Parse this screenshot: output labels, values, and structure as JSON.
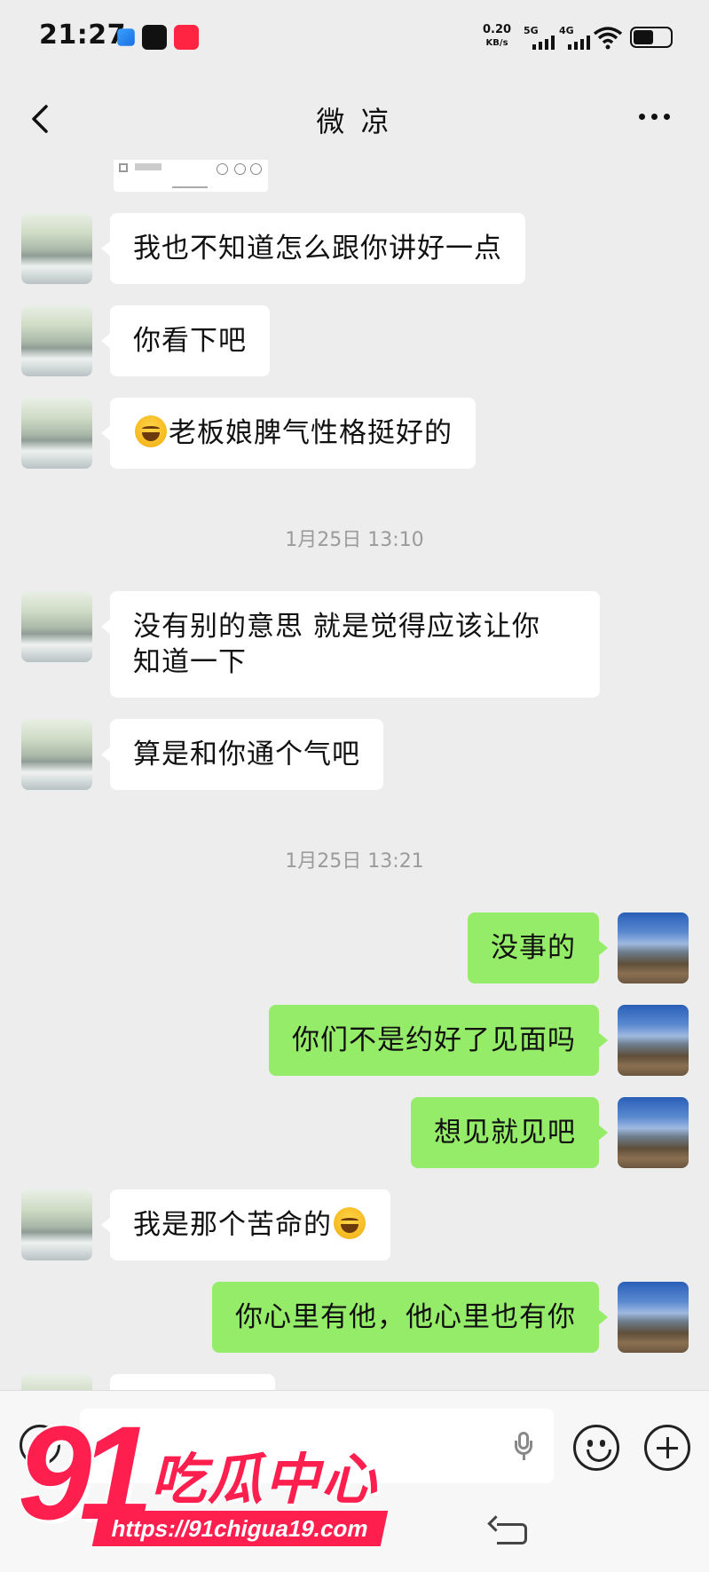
{
  "status_bar": {
    "time": "21:27",
    "net_speed_value": "0.20",
    "net_speed_unit": "KB/s",
    "signal1_label": "5G",
    "signal2_label": "4G"
  },
  "header": {
    "title": "微 凉"
  },
  "messages": [
    {
      "side": "left",
      "text": "我也不知道怎么跟你讲好一点"
    },
    {
      "side": "left",
      "text": "你看下吧"
    },
    {
      "side": "left",
      "text": "老板娘脾气性格挺好的",
      "emoji_before": "face-with-tears-of-joy"
    },
    {
      "side": "left",
      "text": "没有别的意思 就是觉得应该让你",
      "text2": "知道一下"
    },
    {
      "side": "left",
      "text": "算是和你通个气吧"
    },
    {
      "side": "right",
      "text": "没事的"
    },
    {
      "side": "right",
      "text": "你们不是约好了见面吗"
    },
    {
      "side": "right",
      "text": "想见就见吧"
    },
    {
      "side": "left",
      "text": "我是那个苦命的",
      "emoji_after": "face-with-tears-of-joy"
    },
    {
      "side": "right",
      "text": "你心里有他，他心里也有你"
    }
  ],
  "timestamps": [
    "1月25日 13:10",
    "1月25日 13:21"
  ],
  "watermark": {
    "number": "91",
    "text": "吃瓜中心",
    "url": "https://91chigua19.com"
  },
  "colors": {
    "background": "#ededed",
    "sent_bubble": "#95ec69",
    "received_bubble": "#ffffff",
    "watermark": "#ff1f4f"
  }
}
